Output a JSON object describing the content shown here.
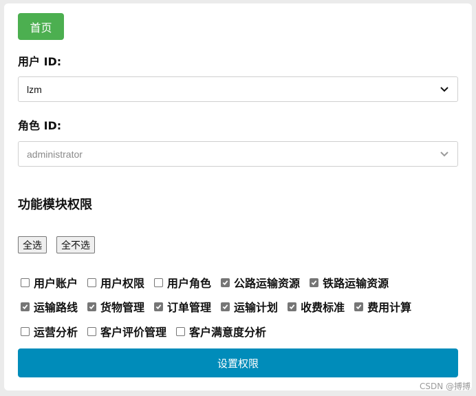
{
  "header": {
    "home_label": "首页"
  },
  "user": {
    "label": "用户 ID:",
    "value": "lzm"
  },
  "role": {
    "label": "角色 ID:",
    "value": "administrator"
  },
  "permissions": {
    "title": "功能模块权限",
    "select_all_label": "全选",
    "select_none_label": "全不选",
    "rows": [
      [
        {
          "label": "用户账户",
          "checked": false
        },
        {
          "label": "用户权限",
          "checked": false
        },
        {
          "label": "用户角色",
          "checked": false
        },
        {
          "label": "公路运输资源",
          "checked": true
        },
        {
          "label": "铁路运输资源",
          "checked": true
        }
      ],
      [
        {
          "label": "运输路线",
          "checked": true
        },
        {
          "label": "货物管理",
          "checked": true
        },
        {
          "label": "订单管理",
          "checked": true
        },
        {
          "label": "运输计划",
          "checked": true
        },
        {
          "label": "收费标准",
          "checked": true
        },
        {
          "label": "费用计算",
          "checked": true
        }
      ],
      [
        {
          "label": "运营分析",
          "checked": false
        },
        {
          "label": "客户评价管理",
          "checked": false
        },
        {
          "label": "客户满意度分析",
          "checked": false
        }
      ]
    ]
  },
  "submit": {
    "label": "设置权限"
  },
  "watermark": "CSDN @搏搏",
  "colors": {
    "home": "#4caf50",
    "submit": "#008cba",
    "check": "#767676"
  }
}
